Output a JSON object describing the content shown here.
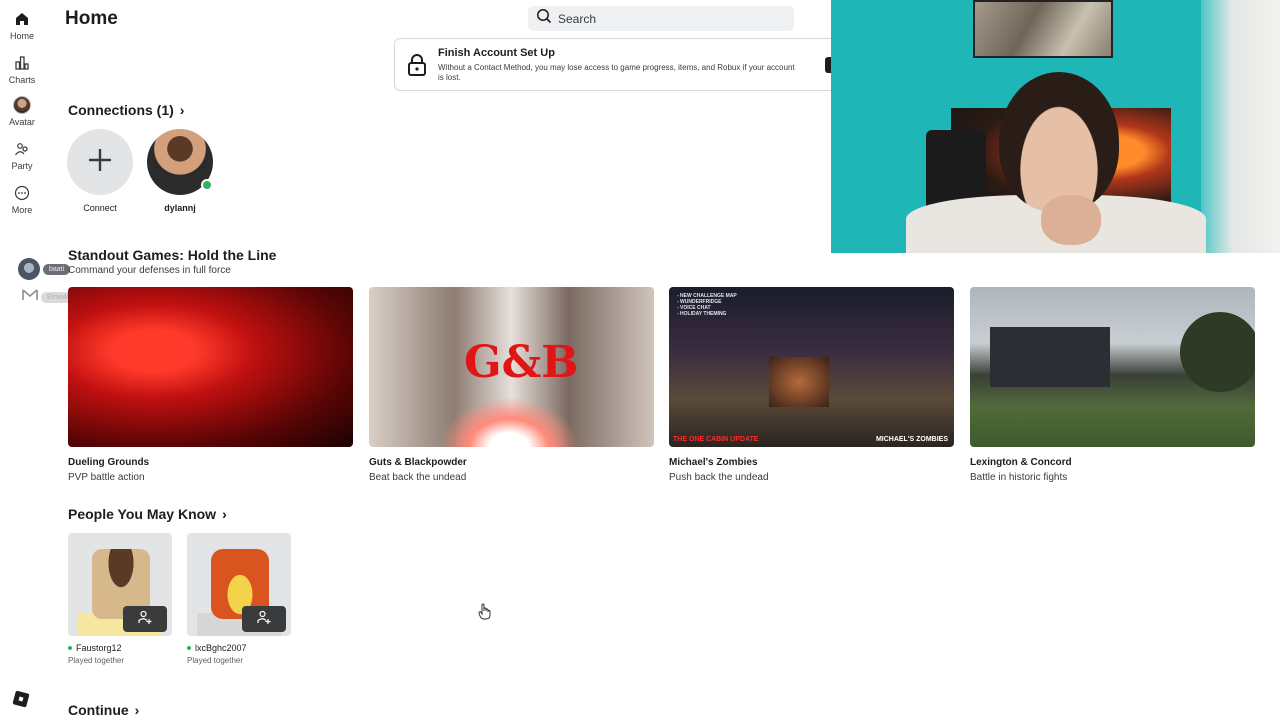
{
  "sidebar": {
    "items": [
      {
        "label": "Home",
        "icon": "home-icon"
      },
      {
        "label": "Charts",
        "icon": "charts-icon"
      },
      {
        "label": "Avatar",
        "icon": "avatar-icon"
      },
      {
        "label": "Party",
        "icon": "party-icon"
      },
      {
        "label": "More",
        "icon": "more-icon"
      }
    ],
    "friends": [
      {
        "tag": "baati"
      },
      {
        "tag": "Elmo402"
      }
    ]
  },
  "header": {
    "title": "Home",
    "search_placeholder": "Search"
  },
  "banner": {
    "title": "Finish Account Set Up",
    "text": "Without a Contact Method, you may lose access to game progress, items, and Robux if your account is lost."
  },
  "connections": {
    "title": "Connections (1)",
    "items": [
      {
        "name": "Connect"
      },
      {
        "name": "dylannj",
        "status": "online"
      }
    ]
  },
  "standout": {
    "title": "Standout Games: Hold the Line",
    "subtitle": "Command your defenses in full force",
    "games": [
      {
        "name": "Dueling Grounds",
        "desc": "PVP battle action"
      },
      {
        "name": "Guts & Blackpowder",
        "desc": "Beat back the undead",
        "art_text": "G&B"
      },
      {
        "name": "Michael's Zombies",
        "desc": "Push back the undead",
        "art_list": [
          "- NEW CHALLENGE MAP",
          "- WUNDERFRIDGE",
          "- VOICE CHAT",
          "- HOLIDAY THEMING"
        ],
        "art_update": "THE ONE CABIN UPDATE",
        "art_brand": "MICHAEL'S ZOMBIES"
      },
      {
        "name": "Lexington & Concord",
        "desc": "Battle in historic fights"
      }
    ]
  },
  "people": {
    "title": "People You May Know",
    "items": [
      {
        "name": "Faustorg12",
        "sub": "Played together"
      },
      {
        "name": "lxcBghc2007",
        "sub": "Played together"
      }
    ]
  },
  "continue": {
    "title": "Continue"
  },
  "colors": {
    "online": "#2fb35e",
    "text": "#1b1d1f",
    "search_bg": "#eff0f1"
  }
}
